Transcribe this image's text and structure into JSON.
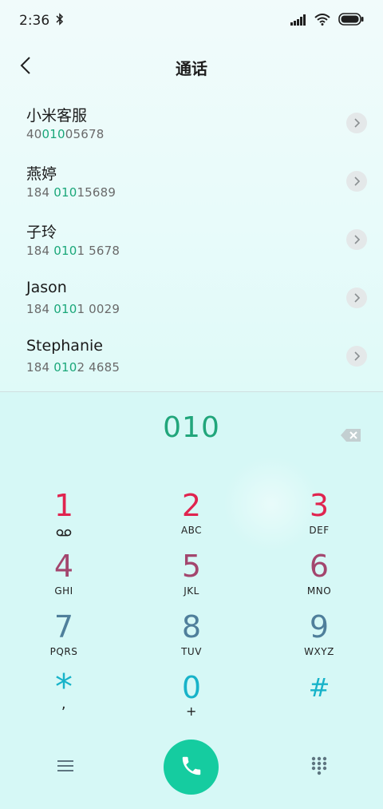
{
  "status_bar": {
    "time": "2:36",
    "icons": [
      "bluetooth-icon",
      "signal-icon",
      "wifi-icon",
      "battery-icon"
    ]
  },
  "header": {
    "title": "通话",
    "back_icon": "chevron-left-icon"
  },
  "suggestions": [
    {
      "name": "小米客服",
      "number_prefix": "40",
      "number_match": "010",
      "number_suffix": "05678"
    },
    {
      "name": "燕婷",
      "number_prefix": "184 ",
      "number_match": "010",
      "number_suffix": "15689"
    },
    {
      "name": "子玲",
      "number_prefix": "184 ",
      "number_match": "010",
      "number_suffix": "1 5678"
    },
    {
      "name": "Jason",
      "number_prefix": "184 ",
      "number_match": "010",
      "number_suffix": "1 0029"
    },
    {
      "name": "Stephanie",
      "number_prefix": "184 ",
      "number_match": "010",
      "number_suffix": "2 4685"
    }
  ],
  "dialer": {
    "entered_number": "010",
    "keys": [
      {
        "digit": "1",
        "letters": "",
        "sub_icon": "voicemail-icon",
        "color": "#e0244f"
      },
      {
        "digit": "2",
        "letters": "ABC",
        "color": "#e0244f"
      },
      {
        "digit": "3",
        "letters": "DEF",
        "color": "#e0244f"
      },
      {
        "digit": "4",
        "letters": "GHI",
        "color": "#a3466e"
      },
      {
        "digit": "5",
        "letters": "JKL",
        "color": "#a3466e"
      },
      {
        "digit": "6",
        "letters": "MNO",
        "color": "#a3466e"
      },
      {
        "digit": "7",
        "letters": "PQRS",
        "color": "#4f7f9b"
      },
      {
        "digit": "8",
        "letters": "TUV",
        "color": "#4f7f9b"
      },
      {
        "digit": "9",
        "letters": "WXYZ",
        "color": "#4f7f9b"
      },
      {
        "digit": "*",
        "letters": ",",
        "color": "#17b3c9"
      },
      {
        "digit": "0",
        "letters": "+",
        "color": "#17b3c9"
      },
      {
        "digit": "#",
        "letters": "",
        "color": "#17b3c9"
      }
    ]
  },
  "colors": {
    "accent": "#21a67b",
    "call_button": "#15cca0"
  }
}
